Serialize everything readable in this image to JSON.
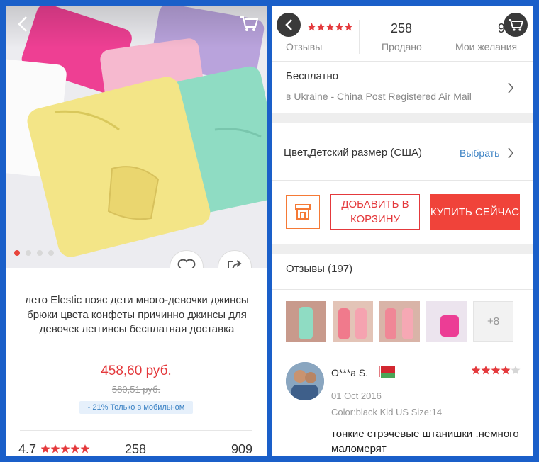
{
  "left": {
    "title": "лето Elestic пояс дети много-девочки джинсы брюки цвета конфеты причинно джинсы для девочек леггинсы бесплатная доставка",
    "price": "458,60 руб.",
    "old_price": "580,51 руб.",
    "badge": "- 21%  Только в мобильном",
    "stats": {
      "rating": "4.7",
      "sold": "258",
      "wishlist": "909"
    },
    "stars_color": "#e4393c"
  },
  "right": {
    "stats": [
      {
        "value": "",
        "label": "Отзывы"
      },
      {
        "value": "258",
        "label": "Продано"
      },
      {
        "value": "9",
        "label": "Мои желания"
      }
    ],
    "shipping": {
      "title": "Бесплатно",
      "detail": "в Ukraine - China Post Registered Air Mail"
    },
    "option": {
      "label": "Цвет,Детский размер (США)",
      "action": "Выбрать"
    },
    "buttons": {
      "add_to_cart": "ДОБАВИТЬ В КОРЗИНУ",
      "buy_now": "КУПИТЬ СЕЙЧАС"
    },
    "reviews": {
      "header": "Отзывы (197)",
      "more_photos": "+8",
      "review": {
        "name": "O***a S.",
        "date": "01 Oct 2016",
        "attributes": "Color:black Kid US Size:14",
        "text": "тонкие стрэчевые штанишки .немного маломерят"
      }
    }
  },
  "colors": {
    "accent": "#e4393c",
    "link": "#3b82c4",
    "store": "#f57a36"
  }
}
